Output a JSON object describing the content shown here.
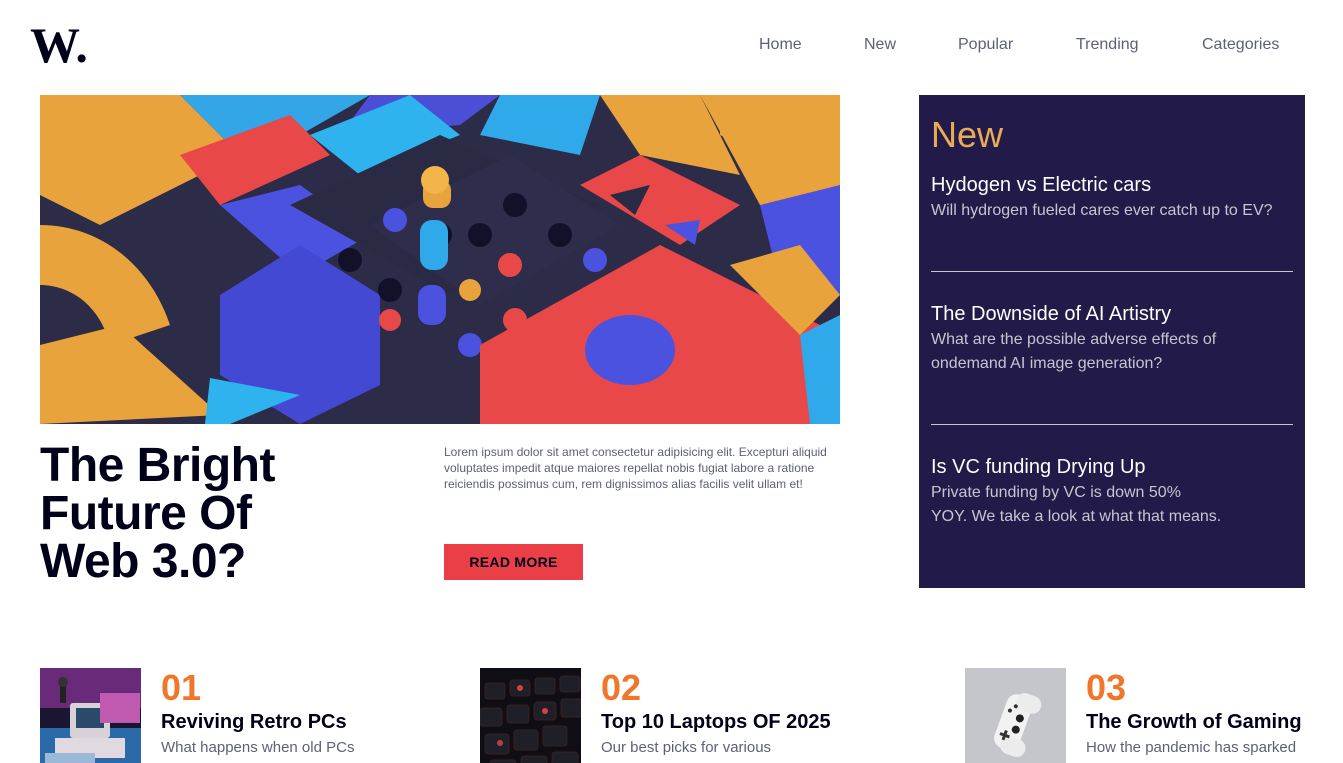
{
  "header": {
    "logo_text": "W.",
    "nav": [
      "Home",
      "New",
      "Popular",
      "Trending",
      "Categories"
    ]
  },
  "hero": {
    "title_lines": [
      "The Bright",
      "Future Of",
      "Web 3.0?"
    ],
    "description": "Lorem ipsum dolor sit amet consectetur adipisicing elit. Excepturi aliquid voluptates impedit atque maiores repellat nobis fugiat labore a ratione reiciendis possimus cum, rem dignissimos alias facilis velit ullam et!",
    "button_label": "READ MORE",
    "image_icon": "abstract-3d-blocks-image"
  },
  "new_panel": {
    "heading": "New",
    "items": [
      {
        "title": "Hydogen vs Electric cars",
        "desc_lines": [
          "Will hydrogen fueled cares ever catch up to EV?"
        ]
      },
      {
        "title": "The Downside of AI Artistry",
        "desc_lines": [
          "What are the possible adverse effects of",
          "ondemand AI image generation?"
        ]
      },
      {
        "title": "Is VC funding Drying Up",
        "desc_lines": [
          "Private funding by VC is down 50%",
          "YOY. We take a look at what that means."
        ]
      }
    ]
  },
  "articles": [
    {
      "number": "01",
      "title": "Reviving Retro PCs",
      "desc": "What happens when old PCs",
      "image_icon": "retro-pc-image"
    },
    {
      "number": "02",
      "title": "Top 10 Laptops OF 2025",
      "desc": "Our best picks for various",
      "image_icon": "laptop-keyboard-image"
    },
    {
      "number": "03",
      "title": "The Growth of Gaming",
      "desc": "How the pandemic has sparked",
      "image_icon": "gamepad-image"
    }
  ],
  "colors": {
    "accent_red": "#ea3f46",
    "accent_orange": "#f0762c",
    "panel_bg": "#221b4a",
    "panel_heading": "#e9ab53",
    "text_dark": "#00001a",
    "text_muted": "#5d5f79"
  }
}
